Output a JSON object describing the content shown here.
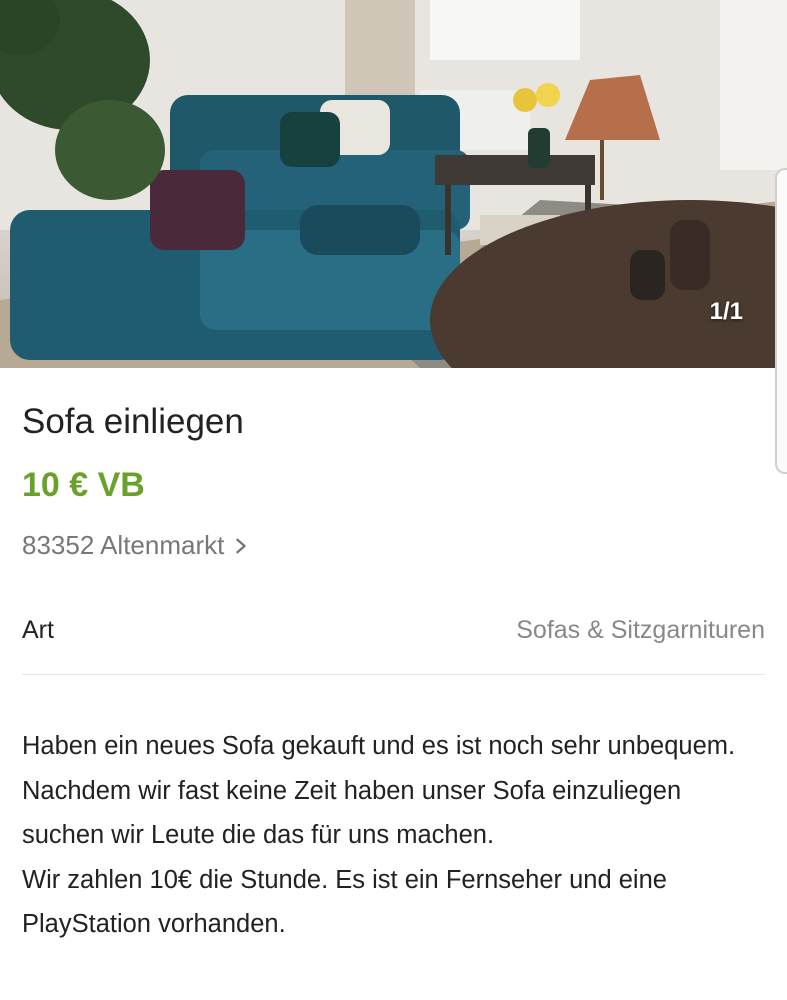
{
  "gallery": {
    "counter": "1/1"
  },
  "listing": {
    "title": "Sofa einliegen",
    "price": "10 € VB",
    "location": "83352 Altenmarkt",
    "location_icon": "chevron-right-icon",
    "attribute": {
      "key": "Art",
      "value": "Sofas & Sitzgarnituren"
    },
    "description": [
      "Haben ein neues Sofa gekauft und es ist noch sehr unbequem. Nachdem wir fast keine Zeit haben unser Sofa einzuliegen suchen wir Leute die das für uns machen.",
      "Wir zahlen 10€ die Stunde. Es ist ein Fernseher und eine PlayStation vorhanden."
    ]
  },
  "colors": {
    "price": "#69a12a",
    "sofa": "#1f5868"
  }
}
